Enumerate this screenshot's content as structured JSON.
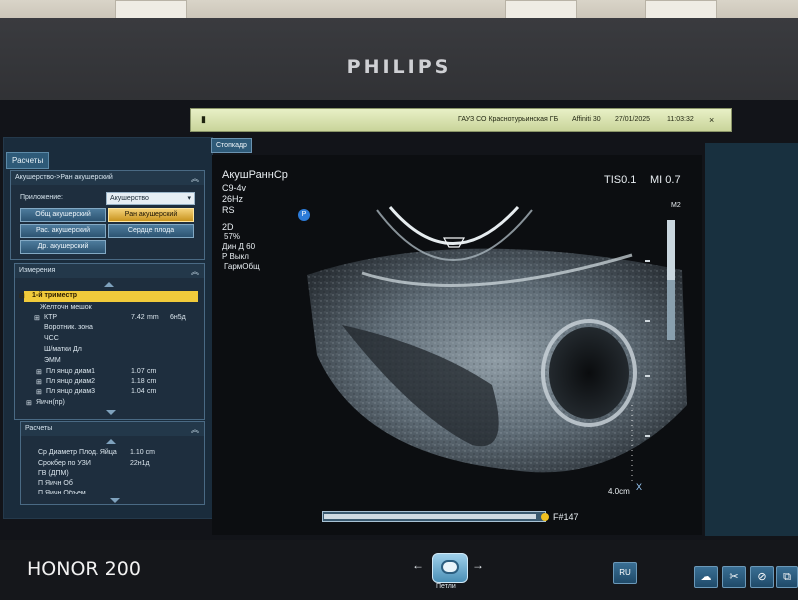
{
  "device": {
    "brand": "PHILIPS",
    "phone_watermark": "HONOR 200"
  },
  "status_bar": {
    "institution": "ГАУЗ СО Краснотурьинская ГБ",
    "system": "Affiniti 30",
    "date": "27/01/2025",
    "time": "11:03:32",
    "close_glyph": "×",
    "left_glyph": "▮"
  },
  "left_panel": {
    "tab_label": "Расчеты",
    "protocol_box": {
      "title": "Акушерство->Ран акушерский",
      "app_label": "Приложение:",
      "app_value": "Акушерство",
      "buttons": [
        {
          "label": "Общ акушерский",
          "active": false
        },
        {
          "label": "Ран акушерский",
          "active": true
        },
        {
          "label": "Рас. акушерский",
          "active": false
        },
        {
          "label": "Сердце плода",
          "active": false
        },
        {
          "label": "Др. акушерский",
          "active": false
        }
      ]
    },
    "measurements": {
      "title": "Измерения",
      "group": "1-й триместр",
      "items": [
        {
          "label": "Желточн мешок",
          "value": "",
          "unit": "",
          "extra": ""
        },
        {
          "label": "КТР",
          "value": "7.42",
          "unit": "mm",
          "extra": "6н5д"
        },
        {
          "label": "Воротник. зона",
          "value": "",
          "unit": "",
          "extra": ""
        },
        {
          "label": "ЧСС",
          "value": "",
          "unit": "",
          "extra": ""
        },
        {
          "label": "Ш/матки Дл",
          "value": "",
          "unit": "",
          "extra": ""
        },
        {
          "label": "ЭММ",
          "value": "",
          "unit": "",
          "extra": ""
        },
        {
          "label": "Пл янцо диам1",
          "value": "1.07",
          "unit": "cm",
          "extra": ""
        },
        {
          "label": "Пл янцо диам2",
          "value": "1.18",
          "unit": "cm",
          "extra": ""
        },
        {
          "label": "Пл янцо диам3",
          "value": "1.04",
          "unit": "cm",
          "extra": ""
        }
      ],
      "last_group": "Яичн(пр)"
    },
    "calculations": {
      "title": "Расчеты",
      "rows": [
        {
          "label": "Ср Диаметр Плод. Яйца",
          "value": "1.10 cm"
        },
        {
          "label": "Срокбер по УЗИ",
          "value": "22н1д"
        },
        {
          "label": "ГВ (ДПМ)",
          "value": ""
        },
        {
          "label": "П Яичн Об",
          "value": ""
        },
        {
          "label": "П Яичн Объем",
          "value": ""
        }
      ]
    }
  },
  "image_area": {
    "freeze_tab": "Стопкадр",
    "preset": "АкушРаннСр",
    "probe": "C9-4v",
    "frame_rate": "26Hz",
    "orientation": "RS",
    "mode_lines": [
      "2D",
      "57%",
      "Дин Д 60",
      "Р Выкл",
      "ГармОбщ"
    ],
    "tis": "TIS0.1",
    "mi": "MI 0.7",
    "gray_map": "M2",
    "depth": "4.0cm",
    "frame_number": "F#147",
    "cursor_glyph": "X"
  },
  "bottom_bar": {
    "loop_label": "Петли",
    "lang": "RU"
  },
  "colors": {
    "accent": "#f1cb3b",
    "panel": "#1a2c3c",
    "status_bar": "#dde7b4"
  }
}
